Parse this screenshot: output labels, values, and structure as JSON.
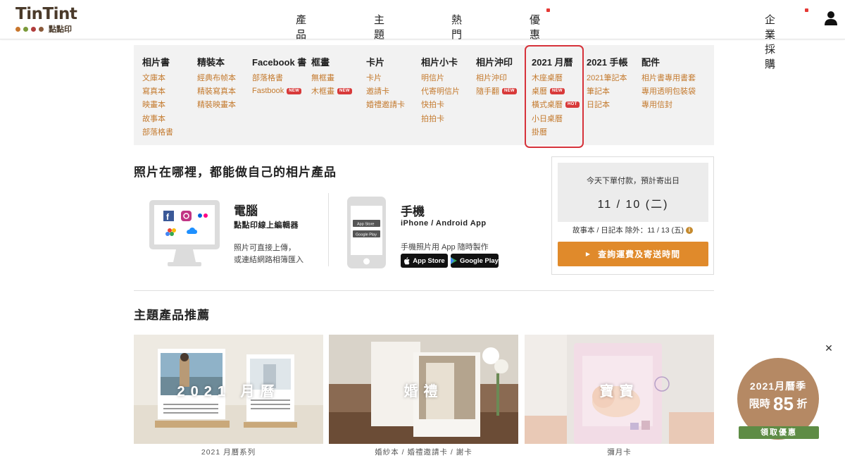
{
  "header": {
    "logo_text": "TinTint",
    "logo_sub": "點點印",
    "logo_dot_colors": [
      "#c8762c",
      "#7a9a3a",
      "#b13d3d",
      "#8a5a3a"
    ],
    "nav": [
      "產品",
      "主題",
      "熱門",
      "優惠"
    ],
    "corporate": "企業採購"
  },
  "menu": {
    "columns": [
      {
        "title": "相片書",
        "items": [
          {
            "label": "文庫本"
          },
          {
            "label": "寫真本"
          },
          {
            "label": "映畫本"
          },
          {
            "label": "故事本"
          },
          {
            "label": "部落格書"
          }
        ]
      },
      {
        "title": "精裝本",
        "items": [
          {
            "label": "經典布帧本"
          },
          {
            "label": "精裝寫真本"
          },
          {
            "label": "精裝映畫本"
          }
        ]
      },
      {
        "title": "Facebook 書",
        "items": [
          {
            "label": "部落格書"
          },
          {
            "label": "Fastbook",
            "badge": "NEW"
          }
        ]
      },
      {
        "title": "框畫",
        "items": [
          {
            "label": "無框畫"
          },
          {
            "label": "木框畫",
            "badge": "NEW"
          }
        ]
      },
      {
        "title": "卡片",
        "items": [
          {
            "label": "卡片"
          },
          {
            "label": "邀請卡"
          },
          {
            "label": "婚禮邀請卡"
          }
        ]
      },
      {
        "title": "相片小卡",
        "items": [
          {
            "label": "明信片"
          },
          {
            "label": "代寄明信片"
          },
          {
            "label": "快拍卡"
          },
          {
            "label": "拍拍卡"
          }
        ]
      },
      {
        "title": "相片沖印",
        "items": [
          {
            "label": "相片沖印"
          },
          {
            "label": "隨手翻",
            "badge": "NEW"
          }
        ]
      },
      {
        "title": "2021 月曆",
        "items": [
          {
            "label": "木座桌曆"
          },
          {
            "label": "桌曆",
            "badge": "NEW"
          },
          {
            "label": "橫式桌曆",
            "badge": "HOT"
          },
          {
            "label": "小日桌曆"
          },
          {
            "label": "掛曆"
          }
        ]
      },
      {
        "title": "2021 手帳",
        "items": [
          {
            "label": "2021筆記本"
          },
          {
            "label": "筆記本"
          },
          {
            "label": "日記本"
          }
        ]
      },
      {
        "title": "配件",
        "items": [
          {
            "label": "相片書專用書套"
          },
          {
            "label": "專用透明包裝袋"
          },
          {
            "label": "專用信封"
          }
        ]
      }
    ]
  },
  "intro": {
    "title": "照片在哪裡，都能做自己的相片產品",
    "pc": {
      "title": "電腦",
      "subtitle": "點點印線上編輯器",
      "desc1": "照片可直接上傳，",
      "desc2": "或連結網路相簿匯入"
    },
    "mobile": {
      "title": "手機",
      "subtitle": "iPhone / Android App",
      "desc": "手機照片用 App 隨時製作",
      "appstore": "App Store",
      "googleplay": "Google Play"
    }
  },
  "shipping": {
    "label": "今天下單付款，預計寄出日",
    "date": "11 / 10 (二)",
    "note": "故事本 / 日記本 除外：11 / 13 (五)",
    "button": "查詢運費及寄送時間"
  },
  "featured": {
    "title": "主題產品推薦",
    "cards": [
      {
        "label": "2021 月曆",
        "caption": "2021 月曆系列"
      },
      {
        "label": "婚禮",
        "caption": "婚紗本 / 婚禮邀請卡 / 謝卡"
      },
      {
        "label": "寶寶",
        "caption": "彌月卡"
      }
    ]
  },
  "promo": {
    "line1": "2021月曆季",
    "line2_pre": "限時",
    "line2_num": "85",
    "line2_post": "折",
    "button": "領取優惠"
  },
  "colors": {
    "accent": "#e08a2b",
    "link": "#c47a2e",
    "highlight": "#d6323a",
    "promo": "#b58964",
    "promo_button": "#5e8c45"
  }
}
